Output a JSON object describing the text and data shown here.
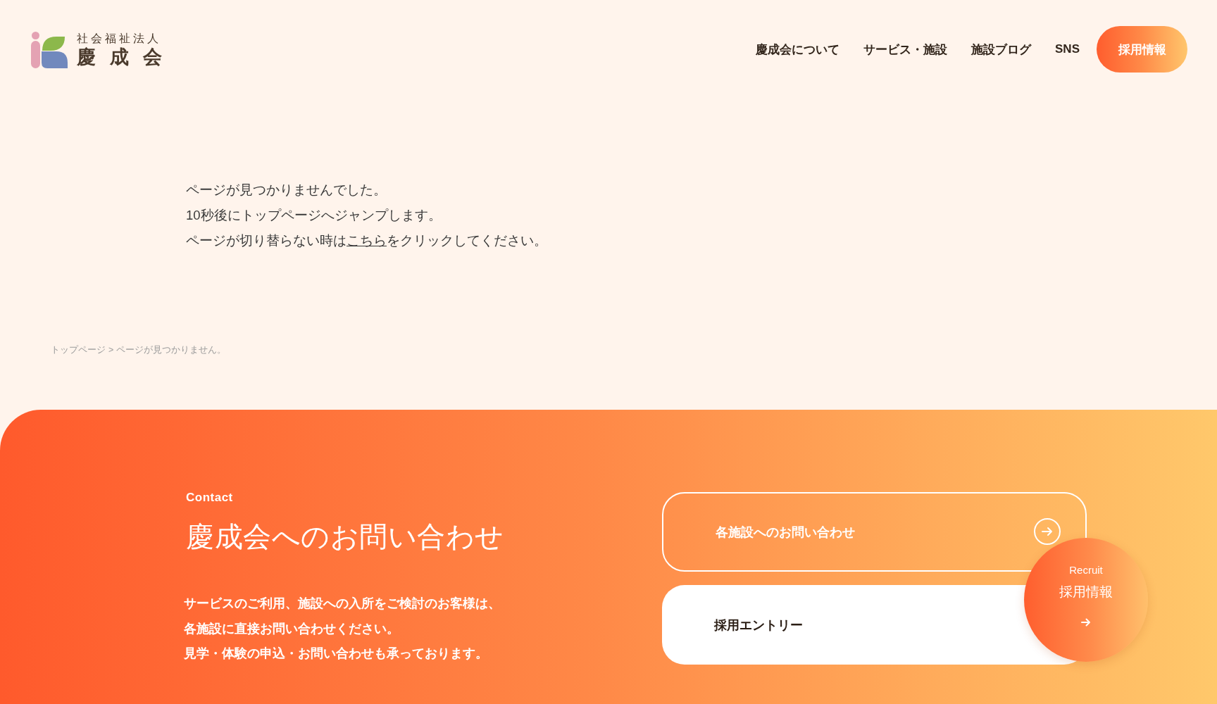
{
  "header": {
    "logo": {
      "subtitle": "社会福祉法人",
      "name": "慶成会"
    },
    "nav": [
      {
        "label": "慶成会について",
        "kind": "link"
      },
      {
        "label": "サービス・施設",
        "kind": "link"
      },
      {
        "label": "施設ブログ",
        "kind": "link"
      },
      {
        "label": "SNS",
        "kind": "link"
      },
      {
        "label": "採用情報",
        "kind": "button"
      }
    ]
  },
  "message": [
    {
      "text": "ページが見つかりませんでした。"
    },
    {
      "text": "10秒後にトップページへジャンプします。"
    },
    {
      "text": "ページが切り替らない時は",
      "link": "こちら",
      "text_after": "をクリックしてください。"
    }
  ],
  "breadcrumb": {
    "items": [
      "トップページ",
      "ページが見つかりません。"
    ],
    "separator": ">"
  },
  "contact": {
    "eyebrow": "Contact",
    "title": "慶成会へのお問い合わせ",
    "description": [
      "サービスのご利用、施設への入所をご検討のお客様は、",
      "各施設に直接お問い合わせください。",
      "見学・体験の申込・お問い合わせも承っております。"
    ],
    "links": [
      {
        "label": "各施設へのお問い合わせ",
        "kind": "outline"
      },
      {
        "label": "採用エントリー",
        "kind": "solid"
      }
    ]
  },
  "recruit_badge": {
    "eyebrow": "Recruit",
    "label": "採用情報"
  }
}
